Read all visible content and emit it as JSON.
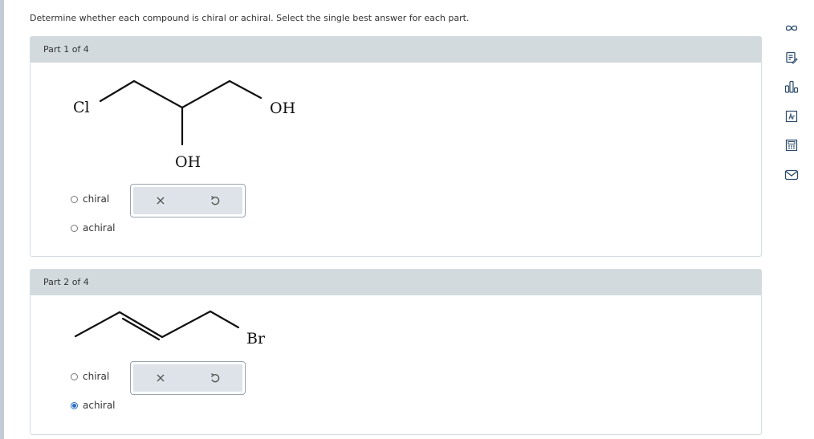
{
  "instructions": "Determine whether each compound is chiral or achiral. Select the single best answer for each part.",
  "parts": [
    {
      "header": "Part 1 of 4",
      "atom_labels": [
        "Cl",
        "OH",
        "OH"
      ],
      "options": [
        {
          "label": "chiral",
          "selected": false
        },
        {
          "label": "achiral",
          "selected": false
        }
      ]
    },
    {
      "header": "Part 2 of 4",
      "atom_labels": [
        "Br"
      ],
      "options": [
        {
          "label": "chiral",
          "selected": false
        },
        {
          "label": "achiral",
          "selected": true
        }
      ]
    }
  ],
  "actions": {
    "clear_icon": "close-icon",
    "undo_icon": "undo-icon"
  },
  "toolbar": [
    "infinity-icon",
    "notes-icon",
    "bar-chart-icon",
    "periodic-table-icon",
    "calculator-icon",
    "mail-icon"
  ],
  "colors": {
    "accent": "#2a6cc4",
    "header_bg": "#d3dade",
    "border": "#d5dbe1"
  }
}
